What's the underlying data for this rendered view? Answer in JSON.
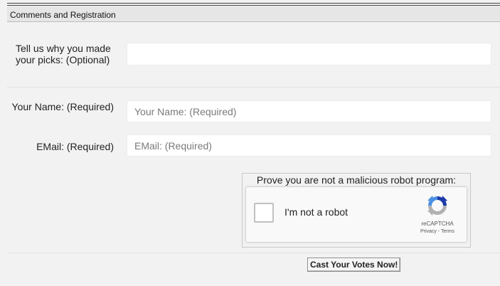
{
  "header": {
    "title": "Comments and Registration"
  },
  "comments": {
    "label": "Tell us why you made your picks: (Optional)",
    "value": ""
  },
  "name": {
    "label": "Your Name: (Required)",
    "placeholder": "Your Name: (Required)",
    "value": ""
  },
  "email": {
    "label": "EMail: (Required)",
    "placeholder": "EMail: (Required)",
    "value": ""
  },
  "captcha": {
    "legend": "Prove you are not a malicious robot program:",
    "checkbox_label": "I'm not a robot",
    "checked": false,
    "brand": "reCAPTCHA",
    "links": "Privacy - Terms",
    "logo_icon": "recaptcha-logo-icon"
  },
  "submit": {
    "label": "Cast Your Votes Now!"
  },
  "colors": {
    "accent_blue": "#1c3aa9",
    "accent_light": "#4a90e2",
    "accent_gray": "#b1b1b1"
  }
}
